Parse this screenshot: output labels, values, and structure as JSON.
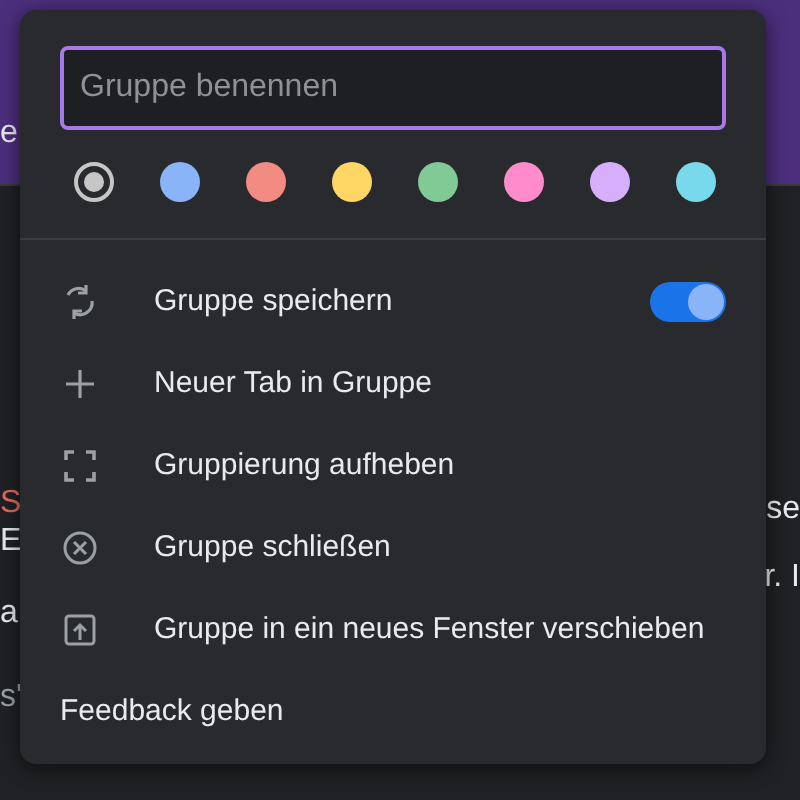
{
  "background": {
    "left_fragments": [
      {
        "text": "e",
        "kind": "light"
      },
      {
        "text": "S",
        "kind": "alert"
      },
      {
        "text": "E",
        "kind": "text"
      },
      {
        "text": "a",
        "kind": "text"
      },
      {
        "text": "s'",
        "kind": "muted"
      }
    ],
    "right_fragments": [
      {
        "text": "se"
      },
      {
        "text": "r. I"
      }
    ]
  },
  "menu": {
    "name_field": {
      "placeholder": "Gruppe benennen"
    },
    "colors": [
      {
        "color": "#c6c6c6",
        "selected": true
      },
      {
        "color": "#8ab4f8",
        "selected": false
      },
      {
        "color": "#f28b82",
        "selected": false
      },
      {
        "color": "#fdd663",
        "selected": false
      },
      {
        "color": "#81c995",
        "selected": false
      },
      {
        "color": "#ff8bcb",
        "selected": false
      },
      {
        "color": "#d7aefb",
        "selected": false
      },
      {
        "color": "#78d9ec",
        "selected": false
      }
    ],
    "items": [
      {
        "label": "Gruppe speichern",
        "kind": "toggle",
        "on": true
      },
      {
        "label": "Neuer Tab in Gruppe",
        "kind": "action"
      },
      {
        "label": "Gruppierung aufheben",
        "kind": "action"
      },
      {
        "label": "Gruppe schließen",
        "kind": "action"
      },
      {
        "label": "Gruppe in ein neues Fenster verschieben",
        "kind": "action"
      }
    ],
    "feedback": {
      "label": "Feedback geben"
    }
  }
}
